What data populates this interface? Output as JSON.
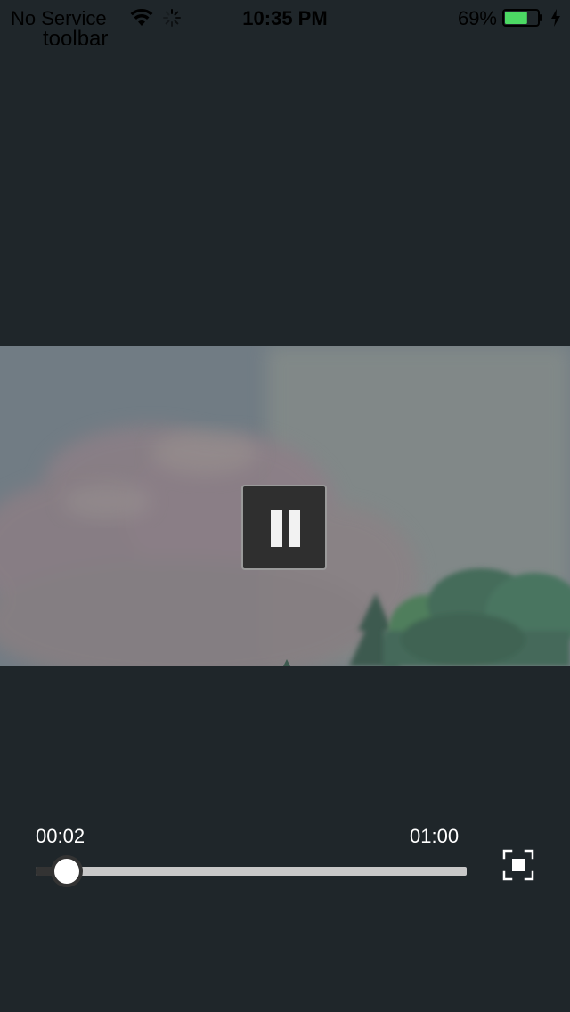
{
  "status_bar": {
    "carrier": "No Service",
    "time": "10:35 PM",
    "battery_percent": "69%",
    "battery_level": 0.69,
    "battery_color": "#4cd964",
    "icons": [
      "wifi-icon",
      "activity-spinner-icon",
      "battery-icon",
      "charging-bolt-icon"
    ]
  },
  "toolbar": {
    "label": "toolbar"
  },
  "player": {
    "current_time": "00:02",
    "total_time": "01:00",
    "progress": 0.0333,
    "state_icon": "pause-icon",
    "fullscreen_icon": "fullscreen-icon"
  }
}
